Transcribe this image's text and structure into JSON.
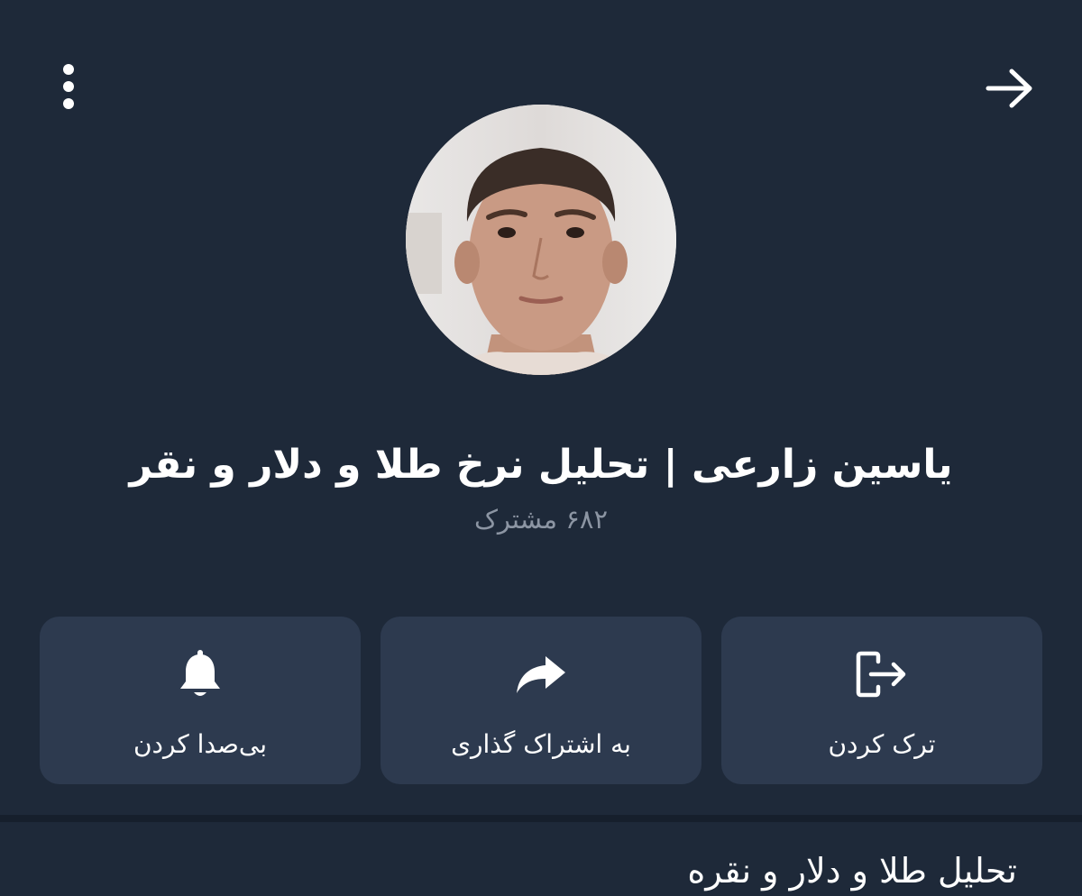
{
  "header": {
    "menu_icon": "more-vertical-icon",
    "back_icon": "arrow-right-icon"
  },
  "channel": {
    "title": "یاسین زارعی | تحلیل نرخ طلا و دلار و نقر",
    "subscribers": "۶۸۲ مشترک",
    "description": "تحلیل طلا و دلار و نقره"
  },
  "actions": {
    "mute": {
      "label": "بی‌صدا کردن",
      "icon": "bell-icon"
    },
    "share": {
      "label": "به اشتراک گذاری",
      "icon": "share-icon"
    },
    "leave": {
      "label": "ترک کردن",
      "icon": "leave-icon"
    }
  },
  "colors": {
    "background": "#1e2939",
    "card": "#2d3a4f",
    "muted_text": "#8c95a3"
  }
}
